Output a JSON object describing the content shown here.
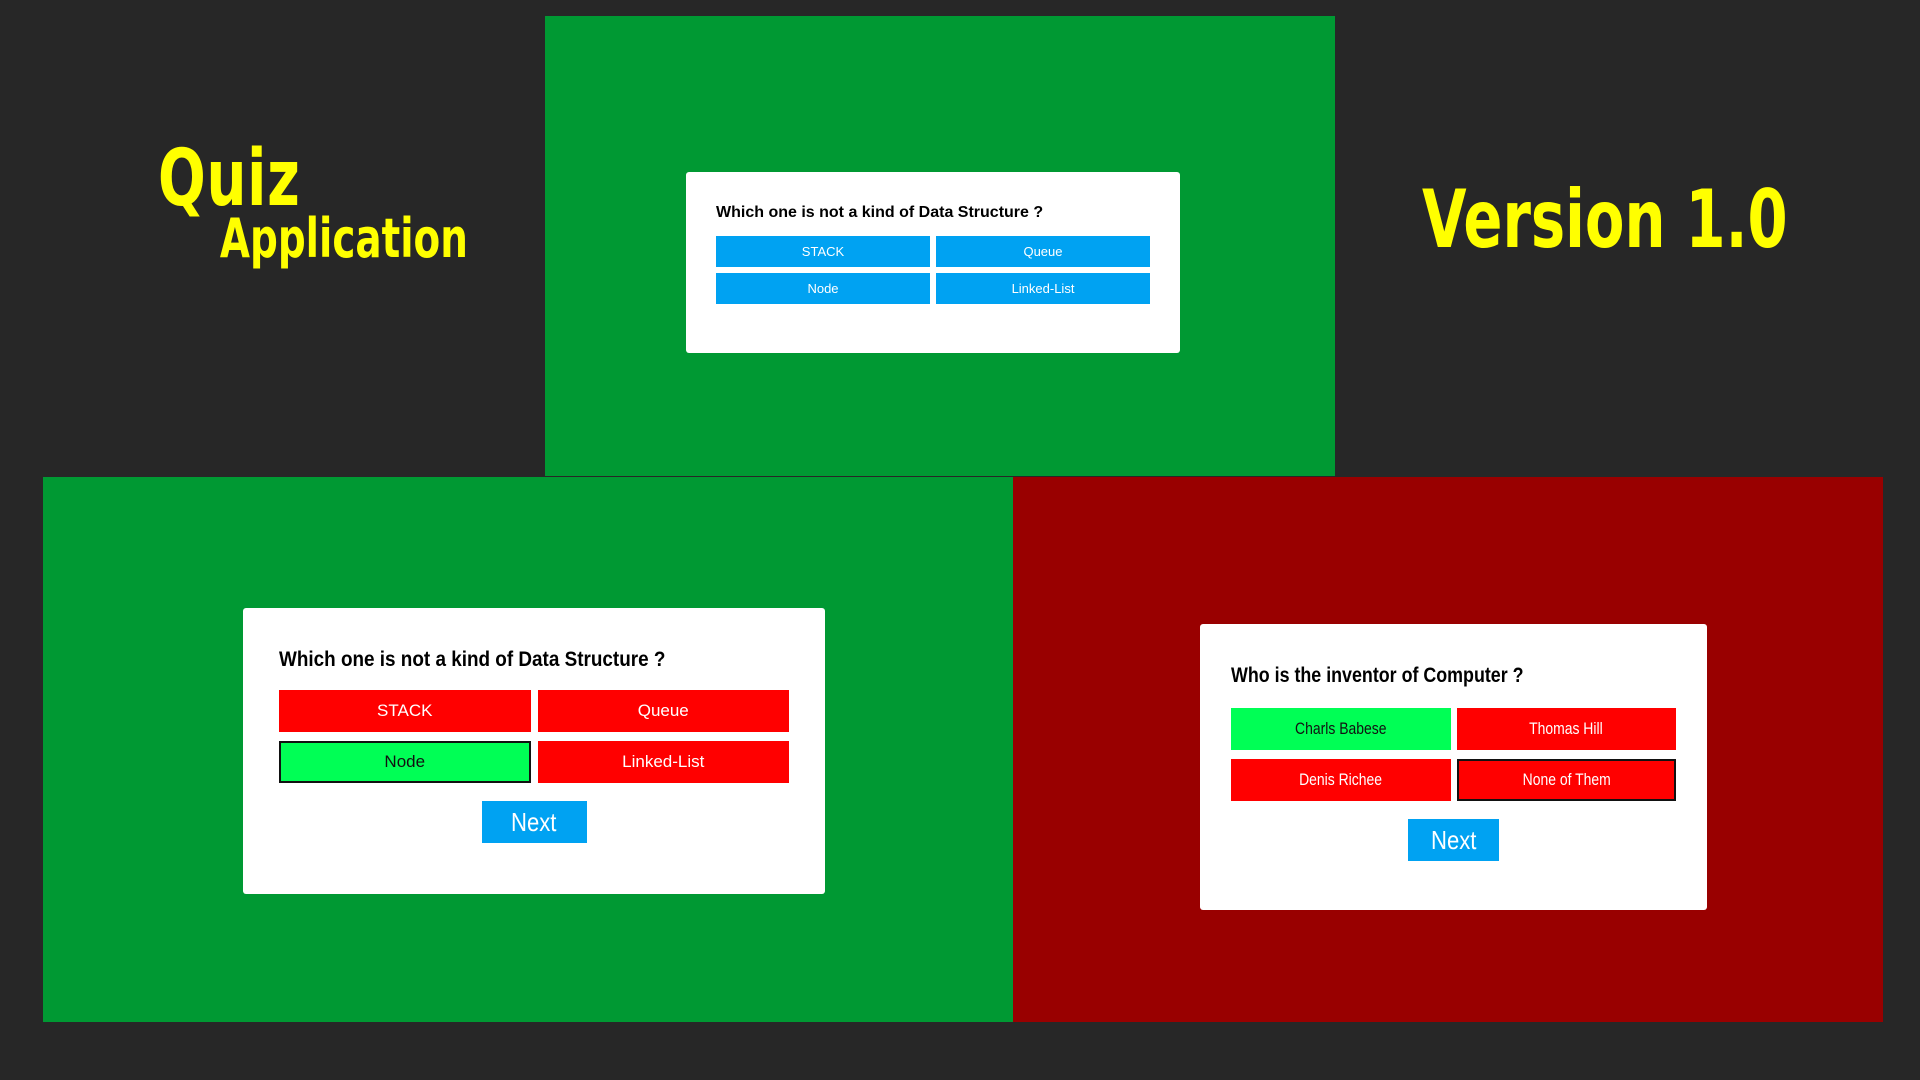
{
  "header": {
    "left_title_line1": "Quiz",
    "left_title_line2": "Application",
    "right_title": "Version 1.0",
    "title_color": "#ffff00"
  },
  "colors": {
    "background": "#272727",
    "correct_panel": "#009933",
    "wrong_panel": "#990000",
    "option_default": "#00a2f2",
    "option_wrong": "#ff0000",
    "option_correct": "#00ff55"
  },
  "top_screen": {
    "question": "Which one is not a kind of Data Structure ?",
    "options": [
      "STACK",
      "Queue",
      "Node",
      "Linked-List"
    ]
  },
  "left_screen": {
    "question": "Which one is not a kind of Data Structure ?",
    "options": [
      "STACK",
      "Queue",
      "Node",
      "Linked-List"
    ],
    "next_label": "Next"
  },
  "right_screen": {
    "question": "Who is the inventor of Computer ?",
    "options": [
      "Charls Babese",
      "Thomas Hill",
      "Denis Richee",
      "None of Them"
    ],
    "next_label": "Next"
  }
}
